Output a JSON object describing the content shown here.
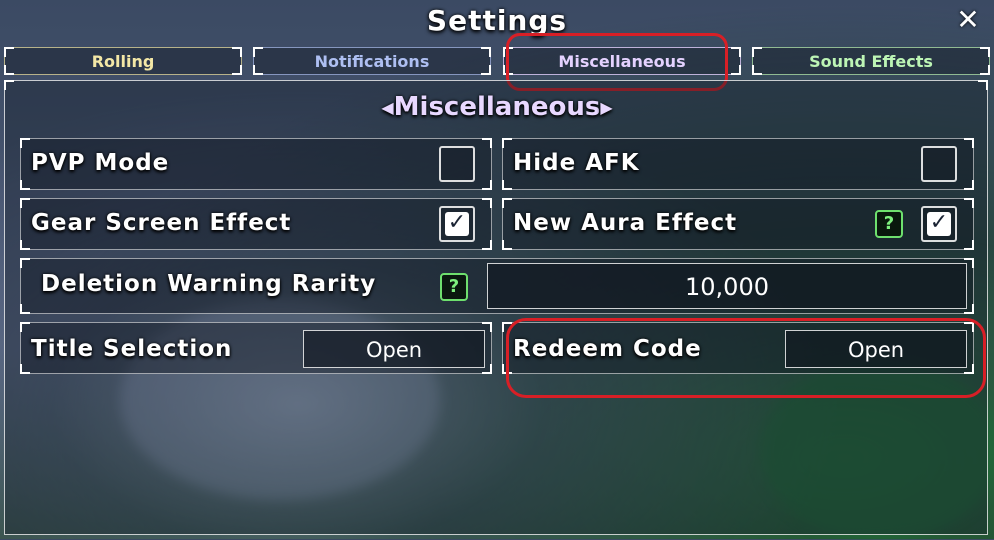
{
  "window": {
    "title": "Settings",
    "close_symbol": "✕"
  },
  "tabs": [
    {
      "label": "Rolling",
      "color": "#f3e7a6"
    },
    {
      "label": "Notifications",
      "color": "#aebff2"
    },
    {
      "label": "Miscellaneous",
      "color": "#e4d2ff"
    },
    {
      "label": "Sound Effects",
      "color": "#bdf5b5"
    }
  ],
  "section": {
    "title": "Miscellaneous",
    "prev_symbol": "◀",
    "next_symbol": "▶"
  },
  "settings": {
    "pvp_mode": {
      "label": "PVP Mode",
      "checked": false
    },
    "hide_afk": {
      "label": "Hide AFK",
      "checked": false
    },
    "gear_screen_effect": {
      "label": "Gear Screen Effect",
      "checked": true
    },
    "new_aura_effect": {
      "label": "New Aura Effect",
      "checked": true,
      "help": "?"
    },
    "deletion_warning_rarity": {
      "label": "Deletion Warning Rarity",
      "help": "?",
      "value": "10,000"
    },
    "title_selection": {
      "label": "Title Selection",
      "button": "Open"
    },
    "redeem_code": {
      "label": "Redeem Code",
      "button": "Open"
    }
  },
  "check_symbol": "✓",
  "colors": {
    "highlight": "#d81f26",
    "help_green": "#6ee06e"
  }
}
